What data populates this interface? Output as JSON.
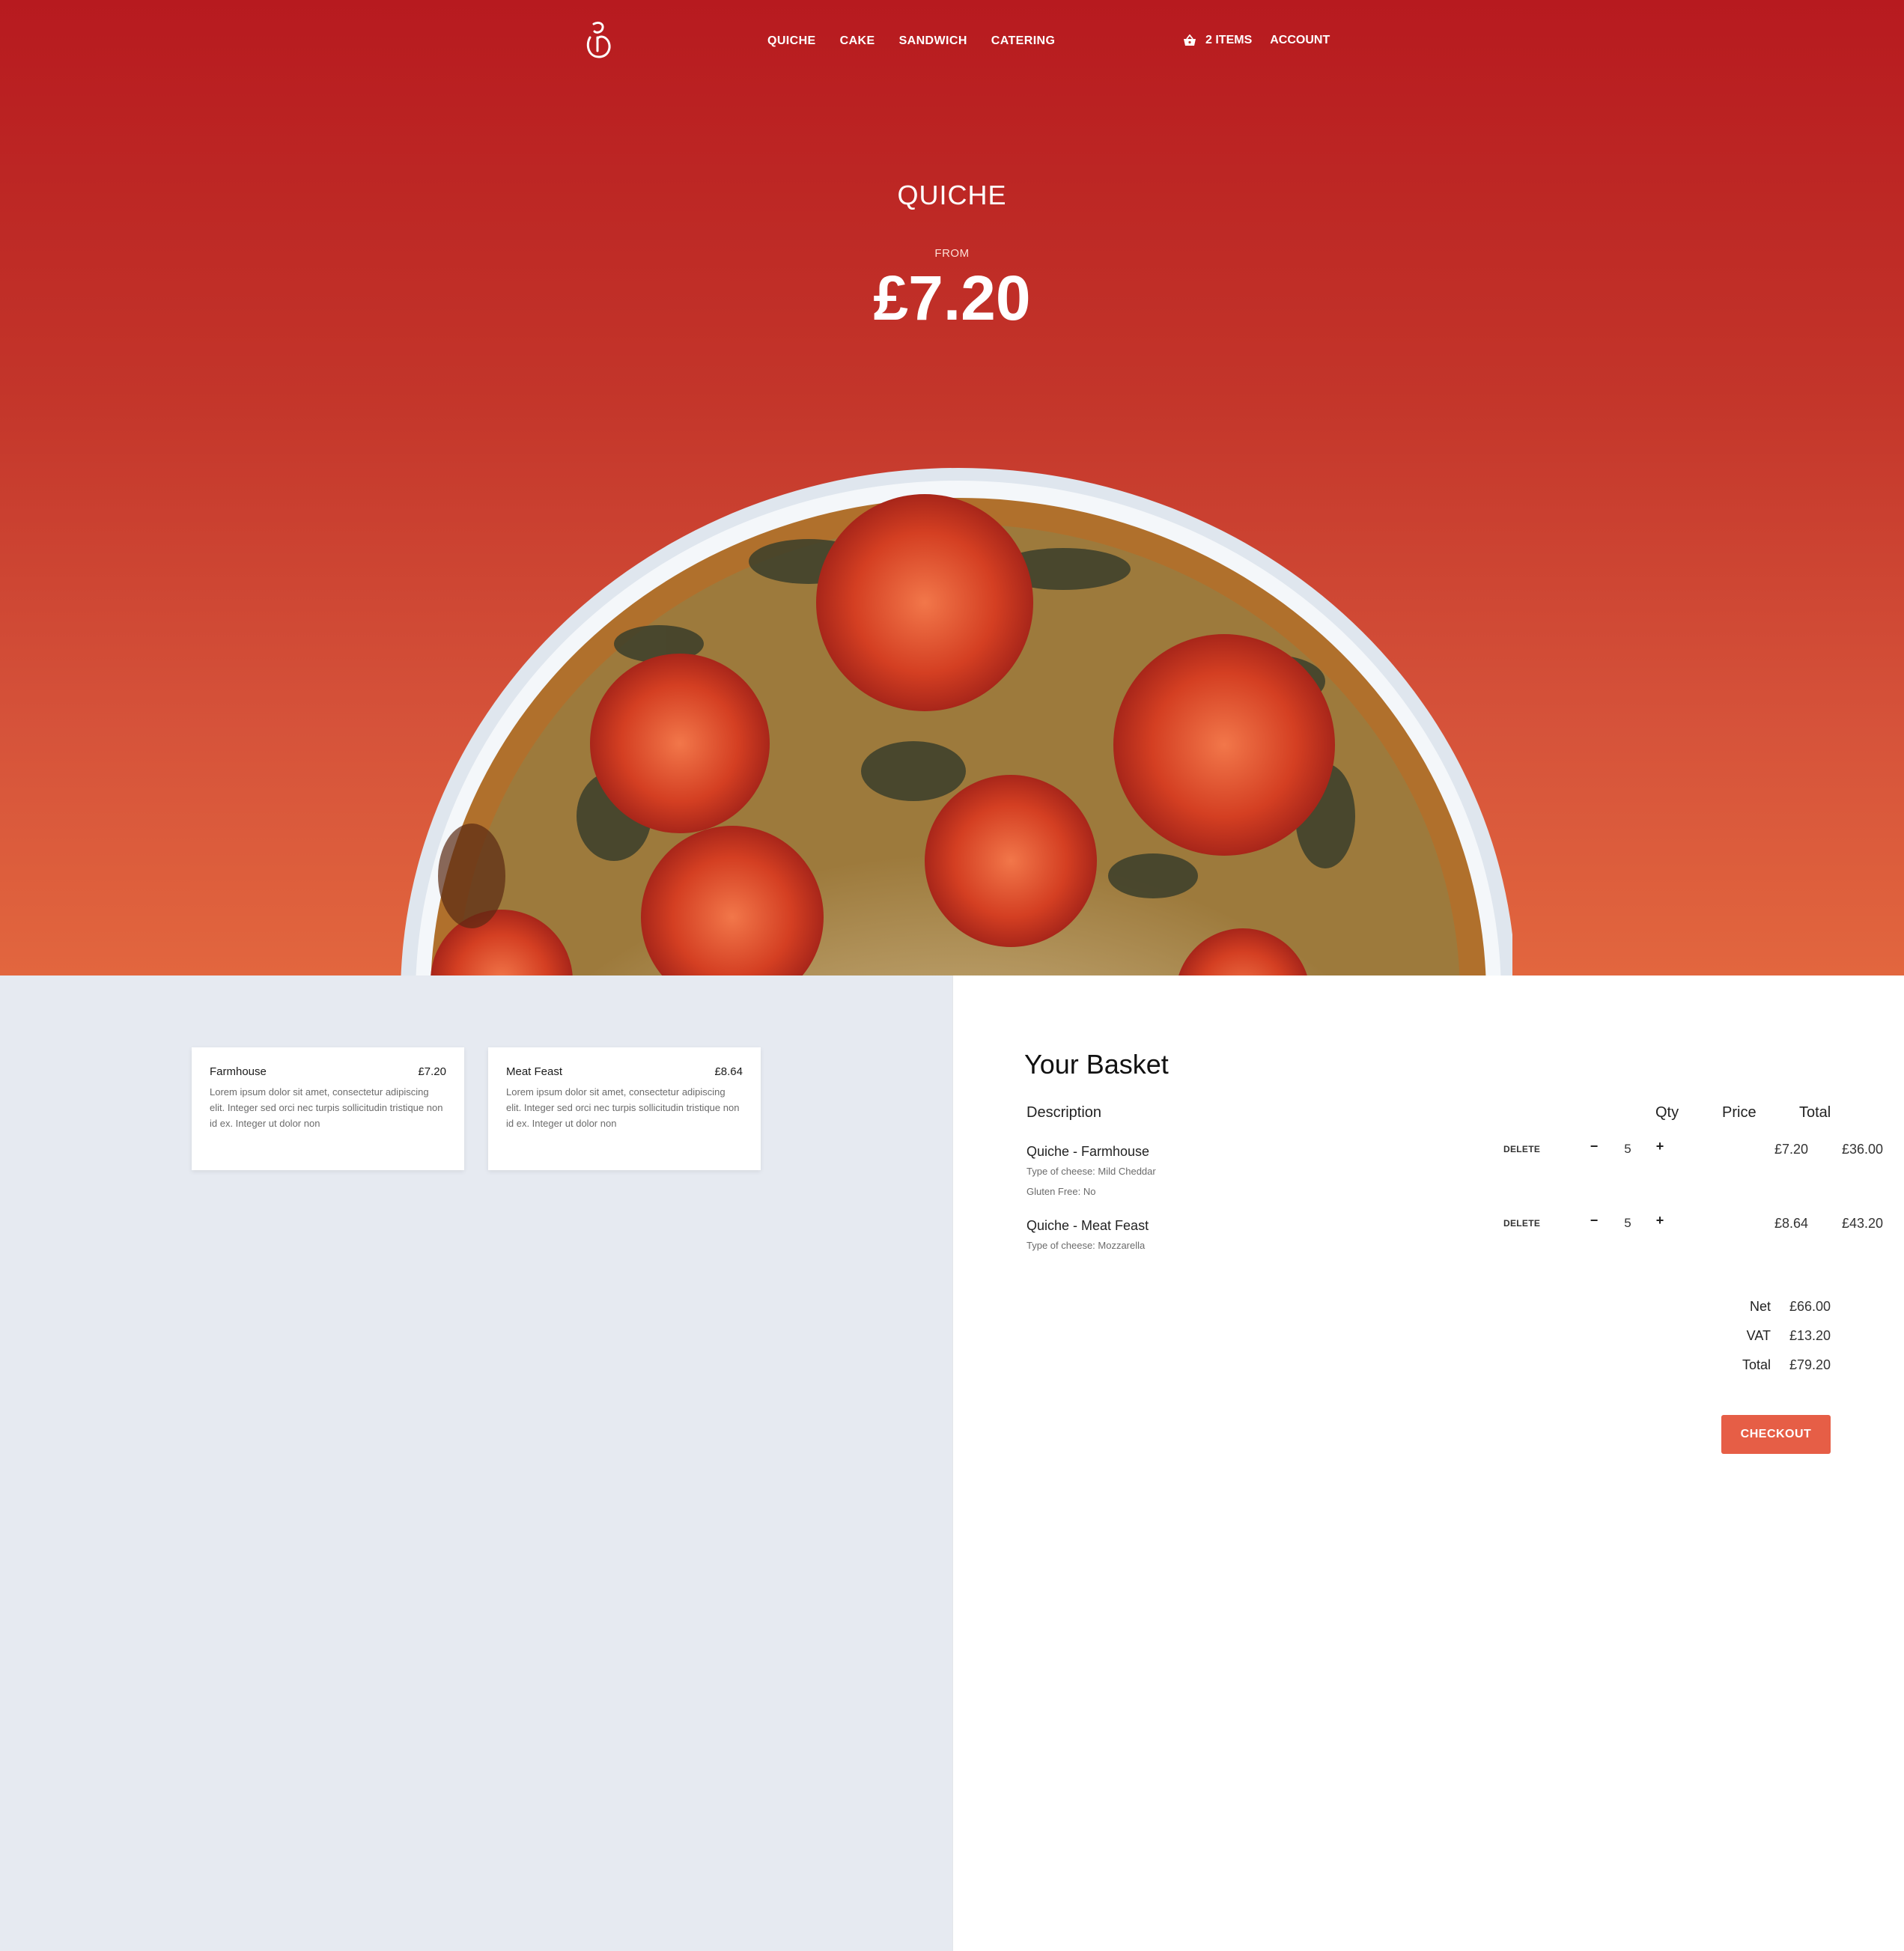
{
  "nav": {
    "links": [
      "QUICHE",
      "CAKE",
      "SANDWICH",
      "CATERING"
    ],
    "basket_label": "2 ITEMS",
    "account_label": "ACCOUNT"
  },
  "hero": {
    "title": "QUICHE",
    "from_label": "FROM",
    "price": "£7.20"
  },
  "products": [
    {
      "name": "Farmhouse",
      "price": "£7.20",
      "description": "Lorem ipsum dolor sit amet, consectetur adipiscing elit. Integer sed orci nec turpis sollicitudin tristique non id ex. Integer ut dolor non"
    },
    {
      "name": "Meat Feast",
      "price": "£8.64",
      "description": "Lorem ipsum dolor sit amet, consectetur adipiscing elit. Integer sed orci nec turpis sollicitudin tristique non id ex. Integer ut dolor non"
    }
  ],
  "basket": {
    "title": "Your Basket",
    "headers": {
      "description": "Description",
      "qty": "Qty",
      "price": "Price",
      "total": "Total"
    },
    "items": [
      {
        "name": "Quiche - Farmhouse",
        "options": [
          "Type of cheese: Mild Cheddar",
          "Gluten Free: No"
        ],
        "delete_label": "DELETE",
        "minus": "−",
        "qty": "5",
        "plus": "+",
        "price": "£7.20",
        "total": "£36.00"
      },
      {
        "name": "Quiche - Meat Feast",
        "options": [
          "Type of cheese: Mozzarella"
        ],
        "delete_label": "DELETE",
        "minus": "−",
        "qty": "5",
        "plus": "+",
        "price": "£8.64",
        "total": "£43.20"
      }
    ],
    "summary": {
      "net_label": "Net",
      "net": "£66.00",
      "vat_label": "VAT",
      "vat": "£13.20",
      "total_label": "Total",
      "total": "£79.20"
    },
    "checkout_label": "CHECKOUT"
  },
  "colors": {
    "hero_top": "#b71a1f",
    "hero_bottom": "#e2663e",
    "checkout": "#e65e46",
    "left_bg": "#e6eaf1"
  },
  "icons": [
    "logo-icon",
    "basket-icon",
    "quiche-image"
  ]
}
